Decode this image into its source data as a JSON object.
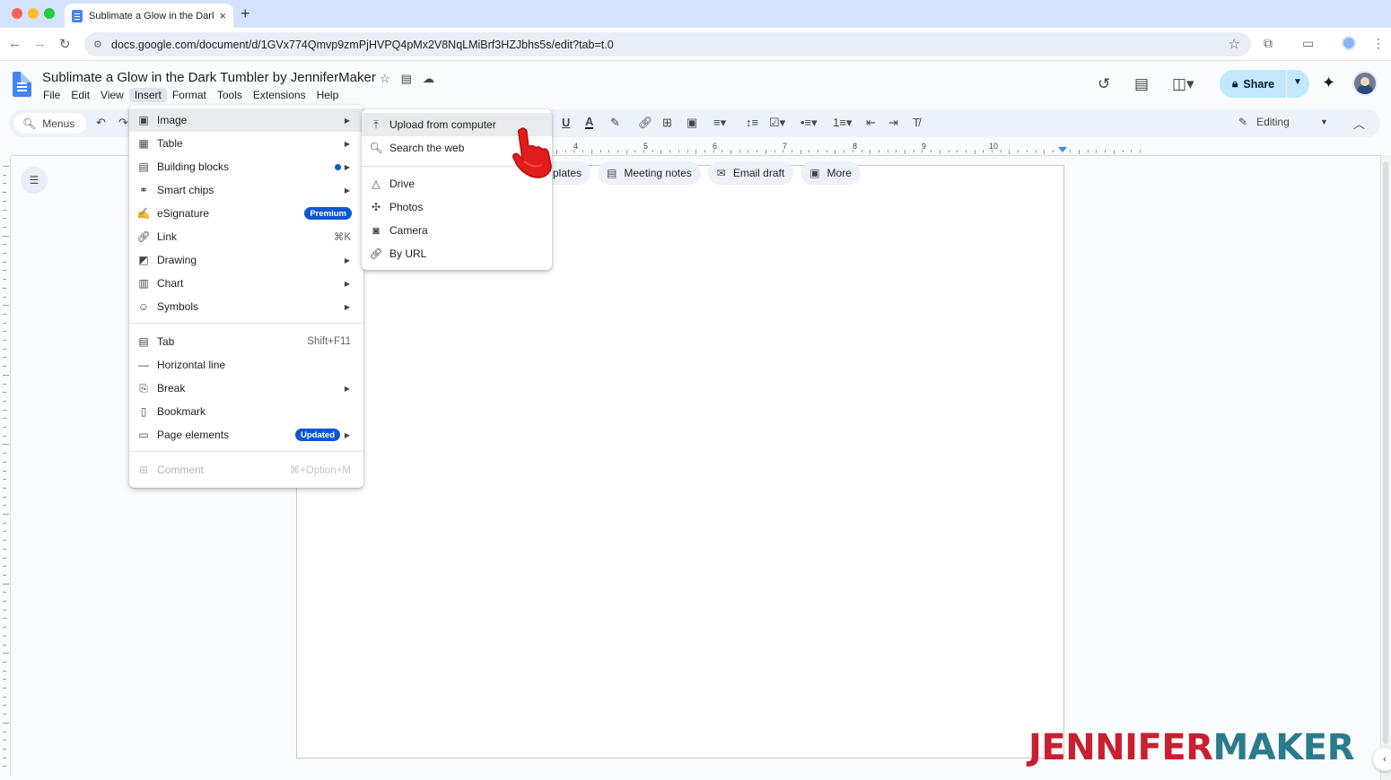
{
  "browser": {
    "tab_title": "Sublimate a Glow in the Dark",
    "tab_close": "×",
    "new_tab": "+",
    "url": "docs.google.com/document/d/1GVx774Qmvp9zmPjHVPQ4pMx2V8NqLMiBrf3HZJbhs5s/edit?tab=t.0",
    "traffic_colors": [
      "#ff5f57",
      "#febc2e",
      "#28c840"
    ]
  },
  "doc": {
    "title": "Sublimate a Glow in the Dark Tumbler by JenniferMaker",
    "menus": [
      "File",
      "Edit",
      "View",
      "Insert",
      "Format",
      "Tools",
      "Extensions",
      "Help"
    ],
    "active_menu": "Insert",
    "share_label": "Share",
    "editing_label": "Editing",
    "menus_search_label": "Menus"
  },
  "chips": [
    {
      "label": "plates",
      "icon": "template-icon"
    },
    {
      "label": "Meeting notes",
      "icon": "document-icon"
    },
    {
      "label": "Email draft",
      "icon": "email-icon"
    },
    {
      "label": "More",
      "icon": "more-icon"
    }
  ],
  "ruler_numbers": [
    "4",
    "5",
    "6",
    "7",
    "8",
    "9",
    "10"
  ],
  "insert_menu": {
    "items": [
      {
        "label": "Image",
        "icon": "image-icon",
        "arrow": true,
        "highlight": true
      },
      {
        "label": "Table",
        "icon": "table-icon",
        "arrow": true
      },
      {
        "label": "Building blocks",
        "icon": "building-blocks-icon",
        "arrow": true,
        "dot": true
      },
      {
        "label": "Smart chips",
        "icon": "smart-chips-icon",
        "arrow": true
      },
      {
        "label": "eSignature",
        "icon": "signature-icon",
        "badge": "Premium"
      },
      {
        "label": "Link",
        "icon": "link-icon",
        "shortcut": "⌘K"
      },
      {
        "label": "Drawing",
        "icon": "drawing-icon",
        "arrow": true
      },
      {
        "label": "Chart",
        "icon": "chart-icon",
        "arrow": true
      },
      {
        "label": "Symbols",
        "icon": "symbols-icon",
        "arrow": true
      },
      {
        "label": "Tab",
        "icon": "tab-icon",
        "shortcut": "Shift+F11"
      },
      {
        "label": "Horizontal line",
        "icon": "horizontal-line-icon"
      },
      {
        "label": "Break",
        "icon": "break-icon",
        "arrow": true
      },
      {
        "label": "Bookmark",
        "icon": "bookmark-icon"
      },
      {
        "label": "Page elements",
        "icon": "page-elements-icon",
        "arrow": true,
        "badge": "Updated"
      },
      {
        "label": "Comment",
        "icon": "comment-icon",
        "shortcut": "⌘+Option+M",
        "disabled": true
      }
    ]
  },
  "image_submenu": {
    "items": [
      {
        "label": "Upload from computer",
        "icon": "upload-icon",
        "highlight": true
      },
      {
        "label": "Search the web",
        "icon": "search-icon"
      },
      {
        "label": "Drive",
        "icon": "drive-icon"
      },
      {
        "label": "Photos",
        "icon": "photos-icon"
      },
      {
        "label": "Camera",
        "icon": "camera-icon"
      },
      {
        "label": "By URL",
        "icon": "link-icon"
      }
    ]
  },
  "watermark": {
    "part1": "JENNIFER",
    "part2": "MAKER",
    "color1": "#c8202f",
    "color2": "#2a7c8c"
  },
  "colors": {
    "share_bg": "#c2e7ff",
    "badge_bg": "#0b57d0",
    "menu_highlight": "#e8eaed",
    "toolbar_bg": "#edf2fa"
  }
}
